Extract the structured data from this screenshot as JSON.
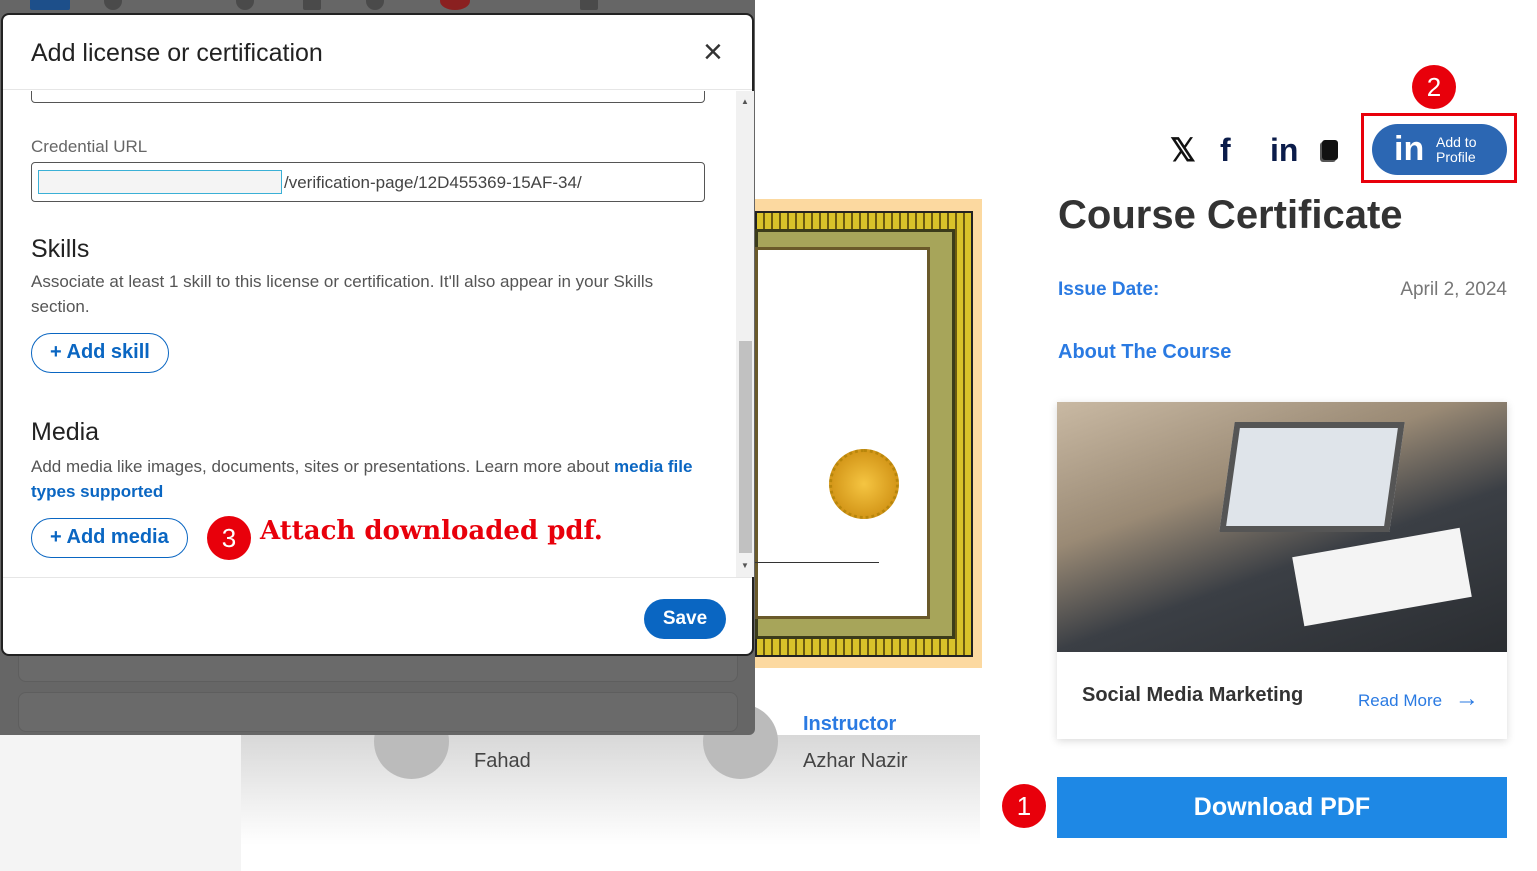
{
  "modal": {
    "title": "Add license or certification",
    "credential_url_label": "Credential URL",
    "credential_url_value": "/verification-page/12D455369-15AF-34/",
    "skills_heading": "Skills",
    "skills_desc": "Associate at least 1 skill to this license or certification. It'll also appear in your Skills section.",
    "add_skill": "+ Add skill",
    "media_heading": "Media",
    "media_desc": "Add media like images, documents, sites or presentations. Learn more about ",
    "media_link": "media file types supported",
    "add_media": "+ Add media",
    "save": "Save"
  },
  "annotations": {
    "step1": "1",
    "step2": "2",
    "step3": "3",
    "step3_text": "Attach downloaded pdf."
  },
  "page": {
    "social_icons": [
      "x-icon",
      "facebook-icon",
      "linkedin-icon",
      "copy-icon"
    ],
    "add_to_profile": "Add to Profile",
    "add_to_profile_line1": "Add to",
    "add_to_profile_line2": "Profile",
    "add_to_profile_logo": "in",
    "title": "Course Certificate",
    "issue_date_label": "Issue Date:",
    "issue_date": "April 2, 2024",
    "about_label": "About The Course",
    "course_name": "Social Media Marketing",
    "read_more": "Read More",
    "download": "Download PDF",
    "student": "Fahad",
    "instructor_label": "Instructor",
    "instructor": "Azhar Nazir"
  },
  "colors": {
    "accent": "#2a7ae2",
    "linkedin": "#0a66c2",
    "download": "#1e88e5",
    "annotation": "#e8000b"
  }
}
